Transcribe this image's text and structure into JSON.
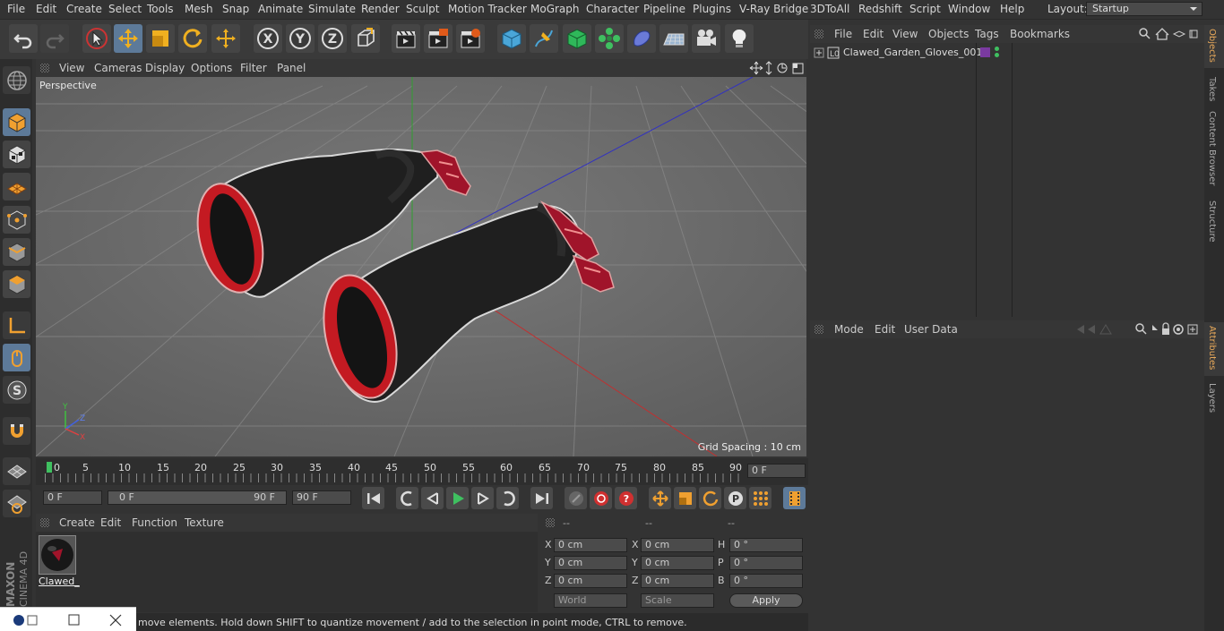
{
  "menubar": {
    "items": [
      "File",
      "Edit",
      "Create",
      "Select",
      "Tools",
      "Mesh",
      "Snap",
      "Animate",
      "Simulate",
      "Render",
      "Sculpt",
      "Motion Tracker",
      "MoGraph",
      "Character",
      "Pipeline",
      "Plugins",
      "V-Ray Bridge",
      "3DToAll",
      "Redshift",
      "Script",
      "Window",
      "Help"
    ],
    "layout_label": "Layout:",
    "layout_value": "Startup"
  },
  "toolbar": {
    "axis_x": "X",
    "axis_y": "Y",
    "axis_z": "Z"
  },
  "viewport": {
    "menu": [
      "View",
      "Cameras",
      "Display",
      "Options",
      "Filter",
      "Panel"
    ],
    "camera_label": "Perspective",
    "grid_spacing": "Grid Spacing : 10 cm"
  },
  "timeline": {
    "ticks": [
      "0",
      "5",
      "10",
      "15",
      "20",
      "25",
      "30",
      "35",
      "40",
      "45",
      "50",
      "55",
      "60",
      "65",
      "70",
      "75",
      "80",
      "85",
      "90"
    ],
    "current_frame": "0 F",
    "start_frame": "0 F",
    "range_start": "0 F",
    "range_end": "90 F",
    "end_frame": "90 F"
  },
  "material_panel": {
    "menu": [
      "Create",
      "Edit",
      "Function",
      "Texture"
    ],
    "material_name": "Clawed_"
  },
  "coords": {
    "headers": [
      "--",
      "--",
      "--"
    ],
    "rows": [
      {
        "l1": "X",
        "v1": "0 cm",
        "l2": "X",
        "v2": "0 cm",
        "l3": "H",
        "v3": "0 °"
      },
      {
        "l1": "Y",
        "v1": "0 cm",
        "l2": "Y",
        "v2": "0 cm",
        "l3": "P",
        "v3": "0 °"
      },
      {
        "l1": "Z",
        "v1": "0 cm",
        "l2": "Z",
        "v2": "0 cm",
        "l3": "B",
        "v3": "0 °"
      }
    ],
    "space": "World",
    "mode": "Scale",
    "apply": "Apply"
  },
  "status": {
    "text": "move elements. Hold down SHIFT to quantize movement / add to the selection in point mode, CTRL to remove."
  },
  "objects_panel": {
    "menu": [
      "File",
      "Edit",
      "View",
      "Objects",
      "Tags",
      "Bookmarks"
    ],
    "object_name": "Clawed_Garden_Gloves_001"
  },
  "attributes_panel": {
    "menu": [
      "Mode",
      "Edit",
      "User Data"
    ]
  },
  "side_tabs": {
    "top": [
      "Objects",
      "Takes",
      "Content Browser",
      "Structure"
    ],
    "bottom": [
      "Attributes",
      "Layers"
    ]
  },
  "brand": {
    "line1": "MAXON",
    "line2": "CINEMA 4D"
  },
  "colors": {
    "accent": "#5d7a99",
    "glove_dark": "#222222",
    "glove_red": "#c41a22",
    "axis_x": "#c03030",
    "axis_y": "#30a030",
    "axis_z": "#3030c0"
  }
}
